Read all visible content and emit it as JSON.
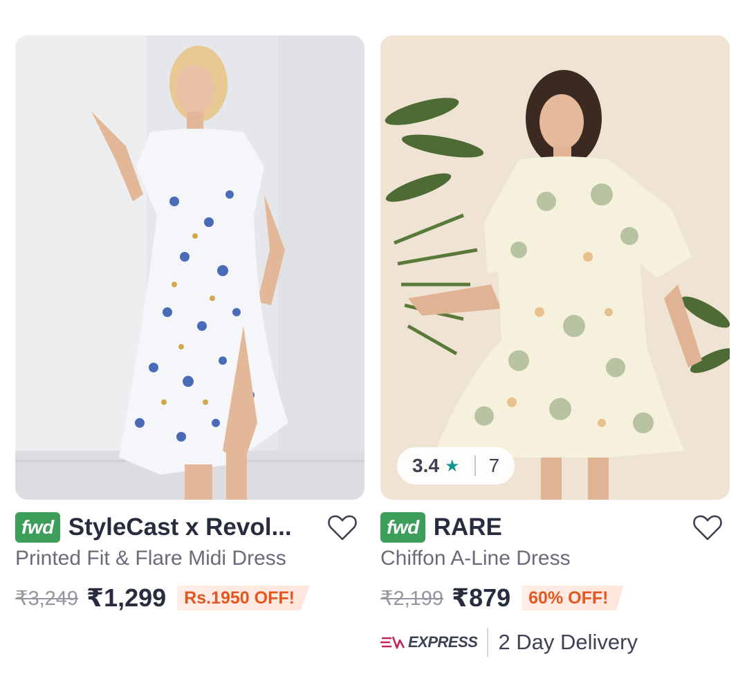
{
  "products": [
    {
      "badge": "fwd",
      "brand": "StyleCast x Revol...",
      "name": "Printed Fit & Flare Midi Dress",
      "mrp": "₹3,249",
      "price": "₹1,299",
      "discount": "Rs.1950 OFF!"
    },
    {
      "badge": "fwd",
      "brand": "RARE",
      "name": "Chiffon A-Line Dress",
      "mrp": "₹2,199",
      "price": "₹879",
      "discount": "60% OFF!",
      "rating": "3.4",
      "rating_star": "★",
      "rating_count": "7",
      "express_label": "EXPRESS",
      "delivery": "2 Day Delivery"
    }
  ],
  "colors": {
    "fwd_green": "#3d9e5a",
    "discount_orange": "#e2571f",
    "express_pink": "#c1255a",
    "rating_teal": "#14958f"
  }
}
